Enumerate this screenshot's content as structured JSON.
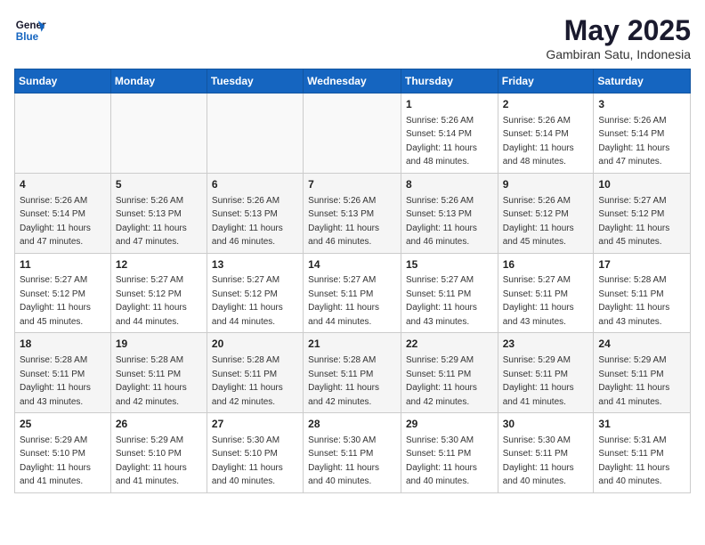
{
  "header": {
    "logo_general": "General",
    "logo_blue": "Blue",
    "title": "May 2025",
    "subtitle": "Gambiran Satu, Indonesia"
  },
  "columns": [
    "Sunday",
    "Monday",
    "Tuesday",
    "Wednesday",
    "Thursday",
    "Friday",
    "Saturday"
  ],
  "weeks": [
    [
      {
        "day": "",
        "info": ""
      },
      {
        "day": "",
        "info": ""
      },
      {
        "day": "",
        "info": ""
      },
      {
        "day": "",
        "info": ""
      },
      {
        "day": "1",
        "info": "Sunrise: 5:26 AM\nSunset: 5:14 PM\nDaylight: 11 hours and 48 minutes."
      },
      {
        "day": "2",
        "info": "Sunrise: 5:26 AM\nSunset: 5:14 PM\nDaylight: 11 hours and 48 minutes."
      },
      {
        "day": "3",
        "info": "Sunrise: 5:26 AM\nSunset: 5:14 PM\nDaylight: 11 hours and 47 minutes."
      }
    ],
    [
      {
        "day": "4",
        "info": "Sunrise: 5:26 AM\nSunset: 5:14 PM\nDaylight: 11 hours and 47 minutes."
      },
      {
        "day": "5",
        "info": "Sunrise: 5:26 AM\nSunset: 5:13 PM\nDaylight: 11 hours and 47 minutes."
      },
      {
        "day": "6",
        "info": "Sunrise: 5:26 AM\nSunset: 5:13 PM\nDaylight: 11 hours and 46 minutes."
      },
      {
        "day": "7",
        "info": "Sunrise: 5:26 AM\nSunset: 5:13 PM\nDaylight: 11 hours and 46 minutes."
      },
      {
        "day": "8",
        "info": "Sunrise: 5:26 AM\nSunset: 5:13 PM\nDaylight: 11 hours and 46 minutes."
      },
      {
        "day": "9",
        "info": "Sunrise: 5:26 AM\nSunset: 5:12 PM\nDaylight: 11 hours and 45 minutes."
      },
      {
        "day": "10",
        "info": "Sunrise: 5:27 AM\nSunset: 5:12 PM\nDaylight: 11 hours and 45 minutes."
      }
    ],
    [
      {
        "day": "11",
        "info": "Sunrise: 5:27 AM\nSunset: 5:12 PM\nDaylight: 11 hours and 45 minutes."
      },
      {
        "day": "12",
        "info": "Sunrise: 5:27 AM\nSunset: 5:12 PM\nDaylight: 11 hours and 44 minutes."
      },
      {
        "day": "13",
        "info": "Sunrise: 5:27 AM\nSunset: 5:12 PM\nDaylight: 11 hours and 44 minutes."
      },
      {
        "day": "14",
        "info": "Sunrise: 5:27 AM\nSunset: 5:11 PM\nDaylight: 11 hours and 44 minutes."
      },
      {
        "day": "15",
        "info": "Sunrise: 5:27 AM\nSunset: 5:11 PM\nDaylight: 11 hours and 43 minutes."
      },
      {
        "day": "16",
        "info": "Sunrise: 5:27 AM\nSunset: 5:11 PM\nDaylight: 11 hours and 43 minutes."
      },
      {
        "day": "17",
        "info": "Sunrise: 5:28 AM\nSunset: 5:11 PM\nDaylight: 11 hours and 43 minutes."
      }
    ],
    [
      {
        "day": "18",
        "info": "Sunrise: 5:28 AM\nSunset: 5:11 PM\nDaylight: 11 hours and 43 minutes."
      },
      {
        "day": "19",
        "info": "Sunrise: 5:28 AM\nSunset: 5:11 PM\nDaylight: 11 hours and 42 minutes."
      },
      {
        "day": "20",
        "info": "Sunrise: 5:28 AM\nSunset: 5:11 PM\nDaylight: 11 hours and 42 minutes."
      },
      {
        "day": "21",
        "info": "Sunrise: 5:28 AM\nSunset: 5:11 PM\nDaylight: 11 hours and 42 minutes."
      },
      {
        "day": "22",
        "info": "Sunrise: 5:29 AM\nSunset: 5:11 PM\nDaylight: 11 hours and 42 minutes."
      },
      {
        "day": "23",
        "info": "Sunrise: 5:29 AM\nSunset: 5:11 PM\nDaylight: 11 hours and 41 minutes."
      },
      {
        "day": "24",
        "info": "Sunrise: 5:29 AM\nSunset: 5:11 PM\nDaylight: 11 hours and 41 minutes."
      }
    ],
    [
      {
        "day": "25",
        "info": "Sunrise: 5:29 AM\nSunset: 5:10 PM\nDaylight: 11 hours and 41 minutes."
      },
      {
        "day": "26",
        "info": "Sunrise: 5:29 AM\nSunset: 5:10 PM\nDaylight: 11 hours and 41 minutes."
      },
      {
        "day": "27",
        "info": "Sunrise: 5:30 AM\nSunset: 5:10 PM\nDaylight: 11 hours and 40 minutes."
      },
      {
        "day": "28",
        "info": "Sunrise: 5:30 AM\nSunset: 5:11 PM\nDaylight: 11 hours and 40 minutes."
      },
      {
        "day": "29",
        "info": "Sunrise: 5:30 AM\nSunset: 5:11 PM\nDaylight: 11 hours and 40 minutes."
      },
      {
        "day": "30",
        "info": "Sunrise: 5:30 AM\nSunset: 5:11 PM\nDaylight: 11 hours and 40 minutes."
      },
      {
        "day": "31",
        "info": "Sunrise: 5:31 AM\nSunset: 5:11 PM\nDaylight: 11 hours and 40 minutes."
      }
    ]
  ]
}
